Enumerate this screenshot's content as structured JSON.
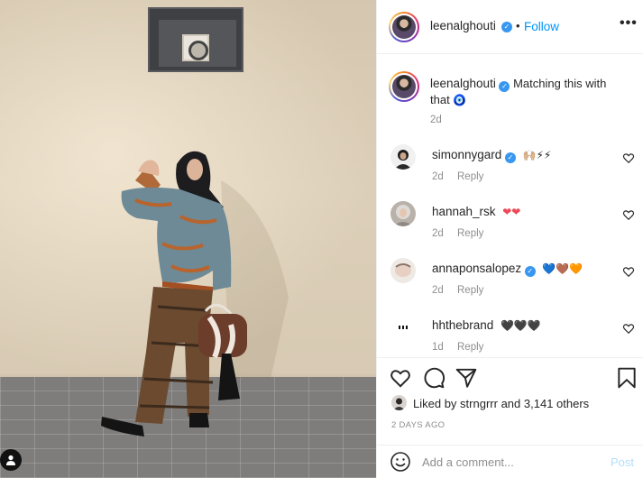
{
  "post": {
    "author": {
      "username": "leenalghouti",
      "verified": true,
      "follow_label": "Follow",
      "separator": "•",
      "avatar_icon": "profile-avatar"
    },
    "caption": {
      "username": "leenalghouti",
      "text": "Matching this with that",
      "emoji": "🧿",
      "time": "2d"
    },
    "comments": [
      {
        "username": "simonnygard",
        "verified": true,
        "text": "🙌🏼⚡⚡",
        "time": "2d",
        "reply_label": "Reply"
      },
      {
        "username": "hannah_rsk",
        "verified": false,
        "text": "❤❤",
        "time": "2d",
        "reply_label": "Reply"
      },
      {
        "username": "annaponsalopez",
        "verified": true,
        "text": "💙🤎🧡",
        "time": "2d",
        "reply_label": "Reply"
      },
      {
        "username": "hhthebrand",
        "verified": false,
        "text": "🖤🖤🖤",
        "time": "1d",
        "reply_label": "Reply"
      }
    ],
    "likes": {
      "prefix": "Liked by",
      "user": "strngrrr",
      "joiner": "and",
      "others": "3,141 others"
    },
    "date": "2 DAYS AGO",
    "add_comment": {
      "placeholder": "Add a comment...",
      "post_label": "Post"
    }
  },
  "icons": {
    "more": "more-options-icon",
    "like": "heart-icon",
    "comment": "comment-bubble-icon",
    "share": "paper-plane-icon",
    "save": "bookmark-icon",
    "emoji": "smiley-icon",
    "account": "account-icon"
  },
  "colors": {
    "link": "#0095f6",
    "verified": "#3897f0",
    "muted": "#8e8e8e",
    "post_disabled": "#b2dffc",
    "text": "#262626"
  }
}
